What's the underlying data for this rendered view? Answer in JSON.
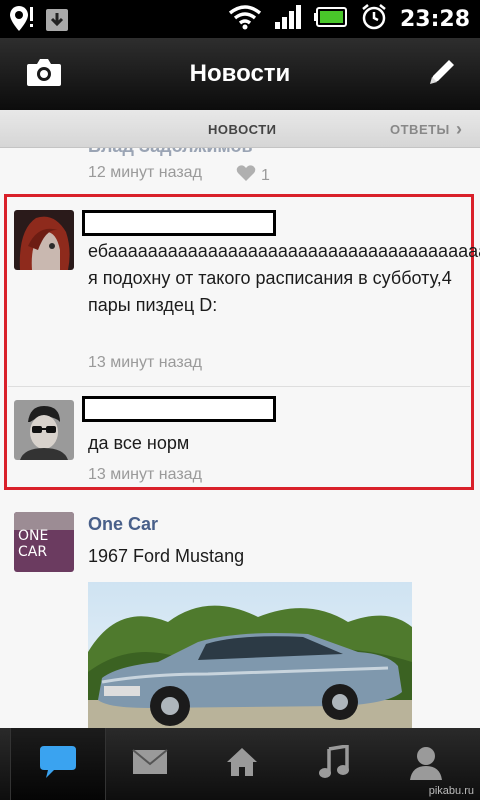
{
  "status_bar": {
    "time": "23:28",
    "icons": [
      "location-alert-icon",
      "download-icon",
      "wifi-icon",
      "signal-icon",
      "battery-icon",
      "alarm-icon"
    ]
  },
  "action_bar": {
    "title": "Новости",
    "left_icon": "camera-icon",
    "right_icon": "pencil-icon"
  },
  "tabs": {
    "news": "НОВОСТИ",
    "answers": "ОТВЕТЫ"
  },
  "feed": {
    "partial_item": {
      "name_cutoff": "Влад Задолжимов",
      "time": "12 минут назад",
      "likes": "1"
    },
    "highlight_color": "#d9202a",
    "posts": [
      {
        "message": "ебаааааааааааааааааааааааааааааааааааааааааааать,чувствую я подохну от такого расписания в субботу,4 пары пиздец D:",
        "time": "13 минут назад"
      },
      {
        "message": "да все норм",
        "time": "13 минут назад"
      }
    ],
    "page_post": {
      "avatar_text": "ONE CAR",
      "name": "One Car",
      "text": "1967 Ford Mustang"
    }
  },
  "bottom_bar": {
    "items": [
      "chat-icon",
      "mail-icon",
      "home-icon",
      "music-icon",
      "profile-icon"
    ],
    "active": "chat-icon"
  },
  "watermark": "pikabu.ru",
  "colors": {
    "link_blue": "#49608a",
    "active_tab_blue": "#3aa3f0"
  }
}
